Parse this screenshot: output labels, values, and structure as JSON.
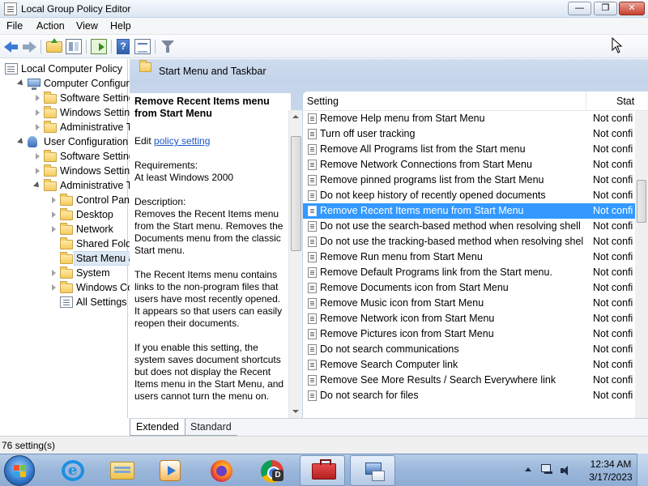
{
  "window": {
    "title": "Local Group Policy Editor",
    "minimize_label": "—",
    "maximize_label": "❐",
    "close_label": "✕"
  },
  "menubar": {
    "items": [
      {
        "label": "File"
      },
      {
        "label": "Action"
      },
      {
        "label": "View"
      },
      {
        "label": "Help"
      }
    ]
  },
  "toolbar": {
    "help_label": "?"
  },
  "tree": {
    "items": [
      {
        "label": "Local Computer Policy",
        "level": 0,
        "expander": "none",
        "icon": "policy-icon"
      },
      {
        "label": "Computer Configura",
        "level": 1,
        "expander": "open",
        "icon": "computer-icon"
      },
      {
        "label": "Software Settings",
        "level": 2,
        "expander": "closed",
        "icon": "folder-icon"
      },
      {
        "label": "Windows Setting",
        "level": 2,
        "expander": "closed",
        "icon": "folder-icon"
      },
      {
        "label": "Administrative Te",
        "level": 2,
        "expander": "closed",
        "icon": "folder-icon"
      },
      {
        "label": "User Configuration",
        "level": 1,
        "expander": "open",
        "icon": "user-icon"
      },
      {
        "label": "Software Settings",
        "level": 2,
        "expander": "closed",
        "icon": "folder-icon"
      },
      {
        "label": "Windows Setting",
        "level": 2,
        "expander": "closed",
        "icon": "folder-icon"
      },
      {
        "label": "Administrative Te",
        "level": 2,
        "expander": "open",
        "icon": "folder-icon"
      },
      {
        "label": "Control Panel",
        "level": 3,
        "expander": "closed",
        "icon": "folder-icon"
      },
      {
        "label": "Desktop",
        "level": 3,
        "expander": "closed",
        "icon": "folder-icon"
      },
      {
        "label": "Network",
        "level": 3,
        "expander": "closed",
        "icon": "folder-icon"
      },
      {
        "label": "Shared Folder",
        "level": 3,
        "expander": "none",
        "icon": "folder-icon"
      },
      {
        "label": "Start Menu ar",
        "level": 3,
        "expander": "none",
        "icon": "folder-icon",
        "selected": true
      },
      {
        "label": "System",
        "level": 3,
        "expander": "closed",
        "icon": "folder-icon"
      },
      {
        "label": "Windows Cor",
        "level": 3,
        "expander": "closed",
        "icon": "folder-icon"
      },
      {
        "label": "All Settings",
        "level": 3,
        "expander": "none",
        "icon": "settings-icon"
      }
    ]
  },
  "header": {
    "title": "Start Menu and Taskbar"
  },
  "description": {
    "title": "Remove Recent Items menu from Start Menu",
    "edit_prefix": "Edit ",
    "edit_link": "policy setting",
    "requirements_label": "Requirements:",
    "requirements_value": "At least Windows 2000",
    "description_label": "Description:",
    "para1": "Removes the Recent Items menu from the Start menu.  Removes the Documents menu from the classic Start menu.",
    "para2": "The Recent Items menu contains links to the non-program files that users have most recently opened. It appears so that users can easily reopen their documents.",
    "para3": "If you enable this setting, the system saves document shortcuts but does not display the Recent Items menu in the Start Menu, and users cannot turn the menu on."
  },
  "settings_list": {
    "columns": {
      "setting": "Setting",
      "state": "Stat"
    },
    "rows": [
      {
        "name": "Remove Help menu from Start Menu",
        "state": "Not confi"
      },
      {
        "name": "Turn off user tracking",
        "state": "Not confi"
      },
      {
        "name": "Remove All Programs list from the Start menu",
        "state": "Not confi"
      },
      {
        "name": "Remove Network Connections from Start Menu",
        "state": "Not confi"
      },
      {
        "name": "Remove pinned programs list from the Start Menu",
        "state": "Not confi"
      },
      {
        "name": "Do not keep history of recently opened documents",
        "state": "Not confi"
      },
      {
        "name": "Remove Recent Items menu from Start Menu",
        "state": "Not confi",
        "selected": true
      },
      {
        "name": "Do not use the search-based method when resolving shell s...",
        "state": "Not confi"
      },
      {
        "name": "Do not use the tracking-based method when resolving shell ...",
        "state": "Not confi"
      },
      {
        "name": "Remove Run menu from Start Menu",
        "state": "Not confi"
      },
      {
        "name": "Remove Default Programs link from the Start menu.",
        "state": "Not confi"
      },
      {
        "name": "Remove Documents icon from Start Menu",
        "state": "Not confi"
      },
      {
        "name": "Remove Music icon from Start Menu",
        "state": "Not confi"
      },
      {
        "name": "Remove Network icon from Start Menu",
        "state": "Not confi"
      },
      {
        "name": "Remove Pictures icon from Start Menu",
        "state": "Not confi"
      },
      {
        "name": "Do not search communications",
        "state": "Not confi"
      },
      {
        "name": "Remove Search Computer link",
        "state": "Not confi"
      },
      {
        "name": "Remove See More Results / Search Everywhere link",
        "state": "Not confi"
      },
      {
        "name": "Do not search for files",
        "state": "Not confi"
      }
    ]
  },
  "tabs": [
    {
      "label": "Extended",
      "active": true
    },
    {
      "label": "Standard",
      "active": false
    }
  ],
  "status": {
    "text": "76 setting(s)"
  },
  "taskbar": {
    "apps": [
      {
        "name": "internet-explorer",
        "active": false
      },
      {
        "name": "file-explorer",
        "active": false
      },
      {
        "name": "media-player",
        "active": false
      },
      {
        "name": "firefox",
        "active": false
      },
      {
        "name": "chrome",
        "active": false,
        "badge": "D"
      },
      {
        "name": "toolbox",
        "active": true
      },
      {
        "name": "group-policy-editor",
        "active": true
      }
    ],
    "clock_time": "12:34 AM",
    "clock_date": "3/17/2023"
  },
  "colors": {
    "selection": "#3399ff",
    "header_band": "#c6d5ea",
    "link": "#1a56c4"
  }
}
